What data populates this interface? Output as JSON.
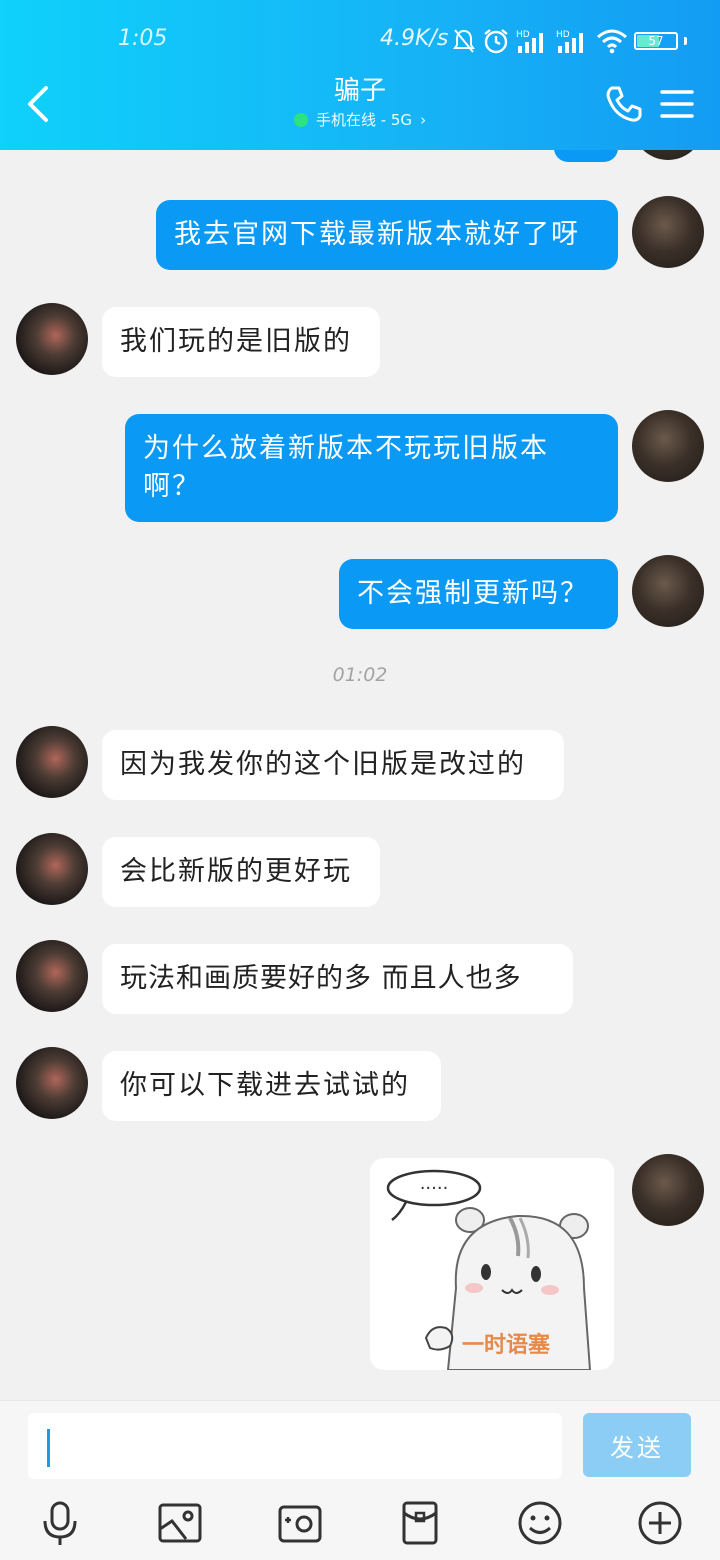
{
  "status_bar": {
    "time": "1:05",
    "net_speed": "4.9K/s",
    "battery": "57"
  },
  "header": {
    "contact_name": "骗子",
    "contact_status": "手机在线 - 5G",
    "status_chevron": "›",
    "icons": [
      "back-icon",
      "phone-icon",
      "menu-icon"
    ]
  },
  "messages": [
    {
      "from": "me",
      "text": "我去官网下载最新版本就好了呀"
    },
    {
      "from": "them",
      "text": "我们玩的是旧版的"
    },
    {
      "from": "me",
      "text_line1": "为什么放着新版本不玩玩旧版本",
      "text_line2": "啊？"
    },
    {
      "from": "me",
      "text": "不会强制更新吗？"
    },
    {
      "from": "them",
      "text": "因为我发你的这个旧版是改过的"
    },
    {
      "from": "them",
      "text": "会比新版的更好玩"
    },
    {
      "from": "them",
      "text": "玩法和画质要好的多 而且人也多"
    },
    {
      "from": "them",
      "text": "你可以下载进去试试的"
    },
    {
      "from": "me",
      "type": "sticker",
      "caption": "一时语塞",
      "thought": "·····"
    }
  ],
  "timestamp": "01:02",
  "composer": {
    "input_value": "",
    "send_label": "发送",
    "toolbar_icons": [
      "microphone-icon",
      "image-icon",
      "camera-icon",
      "red-packet-icon",
      "emoji-icon",
      "plus-icon"
    ]
  },
  "colors": {
    "header_start": "#0fd1fb",
    "header_end": "#139cf3",
    "my_bubble": "#0a99f5",
    "their_bubble": "#ffffff",
    "chat_bg": "#f1f1f1",
    "send_button": "#8ccdf6"
  }
}
